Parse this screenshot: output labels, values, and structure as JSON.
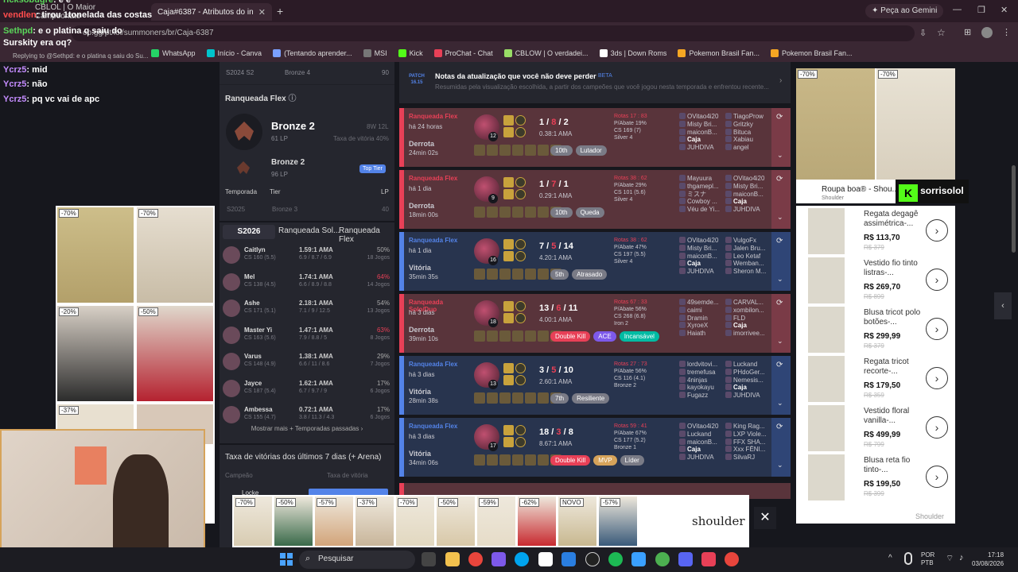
{
  "browser": {
    "tabs": [
      {
        "label": "CBLOL | O Maior Campeonato"
      },
      {
        "label": "Caja#6387 - Atributos do invoc"
      }
    ],
    "new_tab": "+",
    "url": "op.gg/pt/lol/summoners/br/Caja-6387",
    "gemini_button": "Peça ao Gemini",
    "bookmarks": [
      "WhatsApp",
      "Início - Canva",
      "(Tentando aprender...",
      "MSI",
      "Kick",
      "ProChat - Chat",
      "CBLOW | O verdadei...",
      "3ds | Down Roms",
      "Pokemon Brasil Fan...",
      "Pokemon Brasil Fan..."
    ]
  },
  "chat": {
    "lines": [
      {
        "user": "ricksobugre",
        "text": "é é",
        "color": "#5ad65a"
      },
      {
        "user": "vendlen",
        "text": "tirou 1tonelada das costas",
        "color": "#ff4d4d"
      },
      {
        "user": "Sethpd",
        "text": "e o platina q saiu do Surskity era oq?",
        "color": "#5ad65a"
      },
      {
        "user": "",
        "text": "Replying to @Sethpd: e o platina q saiu do Su...",
        "color": "#bbb"
      },
      {
        "user": "Ycrz5",
        "text": "mid",
        "color": "#c48cff"
      },
      {
        "user": "Ycrz5",
        "text": "não",
        "color": "#c48cff"
      },
      {
        "user": "Ycrz5",
        "text": "pq vc vai de apc",
        "color": "#c48cff"
      }
    ]
  },
  "ranked": {
    "prev_season_top": {
      "season": "S2024 S2",
      "tier": "Bronze 4",
      "lp": "90"
    },
    "flex_title": "Ranqueada Flex",
    "current": {
      "tier": "Bronze 2",
      "lp": "61 LP",
      "record": "8W 12L",
      "winrate": "Taxa de vitória 40%"
    },
    "top_tier": {
      "tier": "Bronze 2",
      "lp": "96 LP",
      "badge": "Top Tier"
    },
    "table_headers": [
      "Temporada",
      "Tier",
      "LP"
    ],
    "history": [
      {
        "season": "S2025",
        "tier": "Bronze 3",
        "lp": "40"
      }
    ],
    "tabs": [
      "S2026",
      "Ranqueada Sol...",
      "Ranqueada Flex"
    ]
  },
  "champions": [
    {
      "name": "Caitlyn",
      "cs": "CS 160 (5.5)",
      "kda": "1.59:1 AMA",
      "kd": "6.9 / 8.7 / 6.9",
      "wr": "50%",
      "games": "18 Jogos",
      "wr_color": "#aaa"
    },
    {
      "name": "Mel",
      "cs": "CS 138 (4.5)",
      "kda": "1.74:1 AMA",
      "kd": "6.6 / 8.9 / 8.8",
      "wr": "64%",
      "games": "14 Jogos",
      "wr_color": "#e84057"
    },
    {
      "name": "Ashe",
      "cs": "CS 171 (5.1)",
      "kda": "2.18:1 AMA",
      "kd": "7.1 / 9 / 12.5",
      "wr": "54%",
      "games": "13 Jogos",
      "wr_color": "#aaa"
    },
    {
      "name": "Master Yi",
      "cs": "CS 163 (5.6)",
      "kda": "1.47:1 AMA",
      "kd": "7.9 / 8.8 / 5",
      "wr": "63%",
      "games": "8 Jogos",
      "wr_color": "#e84057"
    },
    {
      "name": "Varus",
      "cs": "CS 148 (4.9)",
      "kda": "1.38:1 AMA",
      "kd": "6.6 / 11 / 8.6",
      "wr": "29%",
      "games": "7 Jogos",
      "wr_color": "#aaa"
    },
    {
      "name": "Jayce",
      "cs": "CS 187 (5.4)",
      "kda": "1.62:1 AMA",
      "kd": "6.7 / 9.7 / 9",
      "wr": "17%",
      "games": "6 Jogos",
      "wr_color": "#aaa"
    },
    {
      "name": "Ambessa",
      "cs": "CS 155 (4.7)",
      "kda": "0.72:1 AMA",
      "kd": "3.8 / 11.3 / 4.3",
      "wr": "17%",
      "games": "6 Jogos",
      "wr_color": "#aaa"
    }
  ],
  "more_link": "Mostrar mais + Temporadas passadas",
  "winrate7": {
    "title": "Taxa de vitórias dos últimos 7 dias (+ Arena)",
    "col1": "Campeão",
    "col2": "Taxa de vitória",
    "first": "Locke"
  },
  "patch": {
    "tag": "PATCH 16.15",
    "title": "Notas da atualização que você não deve perder",
    "beta": "BETA",
    "desc": "Resumidas pela visualização escolhida, a partir dos campeões que você jogou nesta temporada e enfrentou recente..."
  },
  "matches": [
    {
      "queue": "Ranqueada Flex",
      "when": "há 24 horas",
      "result": "Derrota",
      "duration": "24min 02s",
      "outcome": "loss",
      "level": "12",
      "k": "1",
      "d": "8",
      "a": "2",
      "ratio": "0.38:1 AMA",
      "badges": [
        {
          "t": "10th",
          "c": ""
        },
        {
          "t": "Lutador",
          "c": ""
        }
      ],
      "stats": [
        "Rotas 17 : 83",
        "P/Abate 19%",
        "CS 169 (7)",
        "Silver 4"
      ],
      "team1": [
        "OVitao4i20",
        "Misty Bri...",
        "maiconB...",
        "Caja",
        "JUHDIVA"
      ],
      "team2": [
        "TiagoProw",
        "Gritzky",
        "Bituca",
        "Xabiau",
        "angel"
      ]
    },
    {
      "queue": "Ranqueada Flex",
      "when": "há 1 dia",
      "result": "Derrota",
      "duration": "18min 00s",
      "outcome": "loss",
      "level": "9",
      "k": "1",
      "d": "7",
      "a": "1",
      "ratio": "0.29:1 AMA",
      "badges": [
        {
          "t": "10th",
          "c": ""
        },
        {
          "t": "Queda",
          "c": ""
        }
      ],
      "stats": [
        "Rotas 38 : 62",
        "P/Abate 29%",
        "CS 101 (5.6)",
        "Silver 4"
      ],
      "team1": [
        "Mayuura",
        "thgamepl...",
        "ミスナ",
        "Cowboy ...",
        "Véu de Yi..."
      ],
      "team2": [
        "OVitao4i20",
        "Misty Bri...",
        "maiconB...",
        "Caja",
        "JUHDIVA"
      ]
    },
    {
      "queue": "Ranqueada Flex",
      "when": "há 1 dia",
      "result": "Vitória",
      "duration": "35min 35s",
      "outcome": "win",
      "level": "16",
      "k": "7",
      "d": "5",
      "a": "14",
      "ratio": "4.20:1 AMA",
      "badges": [
        {
          "t": "5th",
          "c": ""
        },
        {
          "t": "Atrasado",
          "c": ""
        }
      ],
      "stats": [
        "Rotas 38 : 62",
        "P/Abate 47%",
        "CS 197 (5.5)",
        "Silver 4"
      ],
      "team1": [
        "OVitao4i20",
        "Misty Bri...",
        "maiconB...",
        "Caja",
        "JUHDIVA"
      ],
      "team2": [
        "VulgoFx",
        "Jalen Bru...",
        "Leo Ketaf",
        "Wemban...",
        "Sheron M..."
      ]
    },
    {
      "queue": "Ranqueada Solo/Duo",
      "when": "há 3 dias",
      "result": "Derrota",
      "duration": "39min 10s",
      "outcome": "loss",
      "level": "18",
      "k": "13",
      "d": "6",
      "a": "11",
      "ratio": "4.00:1 AMA",
      "badges": [
        {
          "t": "Double Kill",
          "c": "red"
        },
        {
          "t": "ACE",
          "c": "purple"
        },
        {
          "t": "Incansável",
          "c": "green"
        }
      ],
      "stats": [
        "Rotas 67 : 33",
        "P/Abate 56%",
        "CS 268 (6.8)",
        "Iron 2"
      ],
      "team1": [
        "49semde...",
        "caimi",
        "Dramin",
        "XyroeX",
        "Haiath"
      ],
      "team2": [
        "CARVAL...",
        "xombilon...",
        "FLD",
        "Caja",
        "imorrivee..."
      ]
    },
    {
      "queue": "Ranqueada Flex",
      "when": "há 3 dias",
      "result": "Vitória",
      "duration": "28min 38s",
      "outcome": "win",
      "level": "13",
      "k": "3",
      "d": "5",
      "a": "10",
      "ratio": "2.60:1 AMA",
      "badges": [
        {
          "t": "7th",
          "c": ""
        },
        {
          "t": "Resiliente",
          "c": ""
        }
      ],
      "stats": [
        "Rotas 27 : 73",
        "P/Abate 56%",
        "CS 116 (4.1)",
        "Bronze 2"
      ],
      "team1": [
        "lordvitovi...",
        "tremefusa",
        "4ninjas",
        "kayokayu",
        "Fugazz"
      ],
      "team2": [
        "Luckand",
        "PHdoGer...",
        "Nemesis...",
        "Caja",
        "JUHDIVA"
      ]
    },
    {
      "queue": "Ranqueada Flex",
      "when": "há 3 dias",
      "result": "Vitória",
      "duration": "34min 06s",
      "outcome": "win",
      "level": "17",
      "k": "18",
      "d": "3",
      "a": "8",
      "ratio": "8.67:1 AMA",
      "badges": [
        {
          "t": "Double Kill",
          "c": "red"
        },
        {
          "t": "MVP",
          "c": "gold"
        },
        {
          "t": "Líder",
          "c": ""
        }
      ],
      "stats": [
        "Rotas 59 : 41",
        "P/Abate 67%",
        "CS 177 (5.2)",
        "Bronze 1"
      ],
      "team1": [
        "OVitao4i20",
        "Luckand",
        "maiconB...",
        "Caja",
        "JUHDIVA"
      ],
      "team2": [
        "King Rag...",
        "LXP Viole...",
        "FFX SHA...",
        "Xxx FÊNI...",
        "SilvaRJ"
      ]
    }
  ],
  "ads": {
    "left_discounts": [
      "-70%",
      "-70%",
      "-20%",
      "-50%",
      "-37%"
    ],
    "top_discounts": [
      "-70%",
      "-70%"
    ],
    "top_title": "Roupa boa® - Shou...",
    "top_brand": "Shoulder",
    "streamer": "sorrisolol",
    "items": [
      {
        "name": "Regata degagê assimétrica-...",
        "price": "R$ 113,70",
        "old": "R$ 379"
      },
      {
        "name": "Vestido fio tinto listras-...",
        "price": "R$ 269,70",
        "old": "R$ 899"
      },
      {
        "name": "Blusa tricot polo botões-...",
        "price": "R$ 299,99",
        "old": "R$ 379"
      },
      {
        "name": "Regata tricot recorte-...",
        "price": "R$ 179,50",
        "old": "R$ 359"
      },
      {
        "name": "Vestido floral vanilla-...",
        "price": "R$ 499,99",
        "old": "R$ 799"
      },
      {
        "name": "Blusa reta fio tinto-...",
        "price": "R$ 199,50",
        "old": "R$ 399"
      }
    ],
    "brand_footer": "Shoulder",
    "bottom_discounts": [
      "-70%",
      "-50%",
      "-57%",
      "-37%",
      "-70%",
      "-50%",
      "-59%",
      "-62%",
      "NOVO",
      "-57%"
    ],
    "bottom_brand": "shoulder",
    "close": "✕"
  },
  "taskbar": {
    "search": "Pesquisar",
    "lang1": "POR",
    "lang2": "PTB",
    "time": "17:18",
    "date": "03/08/2026"
  }
}
